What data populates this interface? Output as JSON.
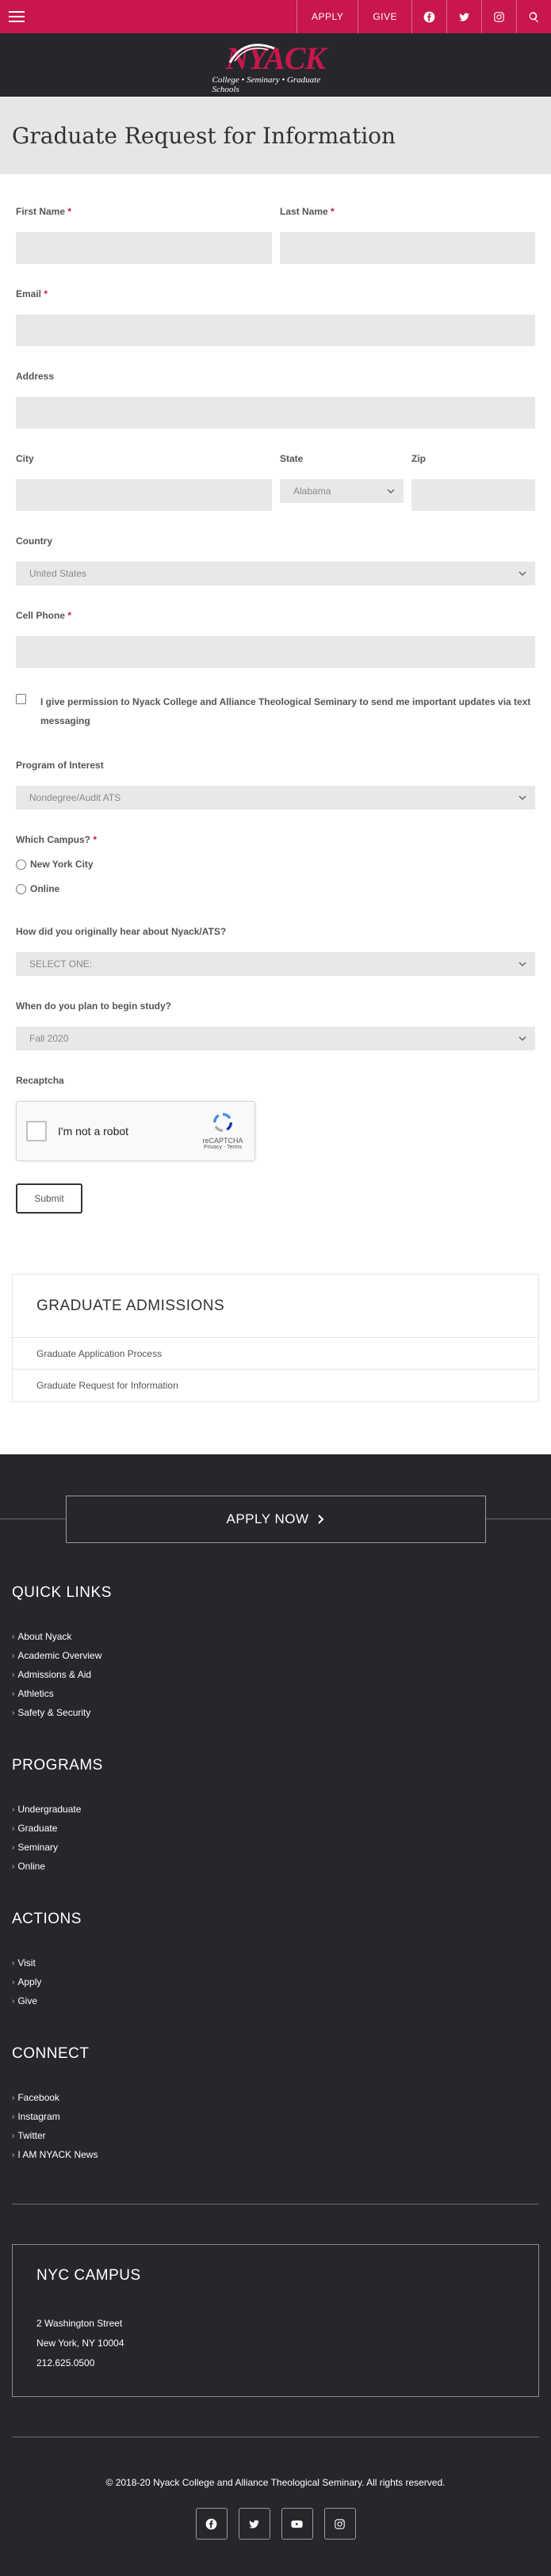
{
  "header": {
    "apply_label": "APPLY",
    "give_label": "GIVE"
  },
  "logo": {
    "word": "NYACK",
    "sub": "College • Seminary • Graduate Schools"
  },
  "page": {
    "title": "Graduate Request for Information"
  },
  "form": {
    "first_name_label": "First Name",
    "last_name_label": "Last Name",
    "email_label": "Email",
    "address_label": "Address",
    "city_label": "City",
    "state_label": "State",
    "state_value": "Alabama",
    "zip_label": "Zip",
    "country_label": "Country",
    "country_value": "United States",
    "cell_label": "Cell Phone",
    "consent_text": "I give permission to Nyack College and Alliance Theological Seminary to send me important updates via text messaging",
    "program_label": "Program of Interest",
    "program_value": "Nondegree/Audit ATS",
    "campus_label": "Which Campus?",
    "campus_options": [
      "New York City",
      "Online"
    ],
    "hear_label": "How did you originally hear about Nyack/ATS?",
    "hear_value": "SELECT ONE:",
    "begin_label": "When do you plan to begin study?",
    "begin_value": "Fall 2020",
    "recaptcha_label": "Recaptcha",
    "recaptcha_text": "I'm not a robot",
    "recaptcha_brand": "reCAPTCHA",
    "recaptcha_terms": "Privacy - Terms",
    "submit_label": "Submit",
    "required_mark": "*"
  },
  "admissions": {
    "title": "GRADUATE ADMISSIONS",
    "links": [
      "Graduate Application Process",
      "Graduate Request for Information"
    ]
  },
  "footer": {
    "apply_now": "APPLY NOW",
    "quick_links_title": "QUICK LINKS",
    "quick_links": [
      "About Nyack",
      "Academic Overview",
      "Admissions & Aid",
      "Athletics",
      "Safety & Security"
    ],
    "programs_title": "PROGRAMS",
    "programs": [
      "Undergraduate",
      "Graduate",
      "Seminary",
      "Online"
    ],
    "actions_title": "ACTIONS",
    "actions": [
      "Visit",
      "Apply",
      "Give"
    ],
    "connect_title": "CONNECT",
    "connect": [
      "Facebook",
      "Instagram",
      "Twitter",
      "I AM NYACK News"
    ],
    "campus_title": "NYC CAMPUS",
    "campus_lines": [
      "2 Washington Street",
      "New York, NY 10004",
      "212.625.0500"
    ],
    "copyright": "© 2018-20 Nyack College and Alliance Theological Seminary. All rights reserved."
  },
  "colors": {
    "brand": "#c8174c",
    "dark": "#26272c"
  },
  "icons": [
    "hamburger-icon",
    "facebook-icon",
    "twitter-icon",
    "instagram-icon",
    "search-icon",
    "youtube-icon",
    "chevron-down-icon",
    "chevron-right-icon"
  ]
}
